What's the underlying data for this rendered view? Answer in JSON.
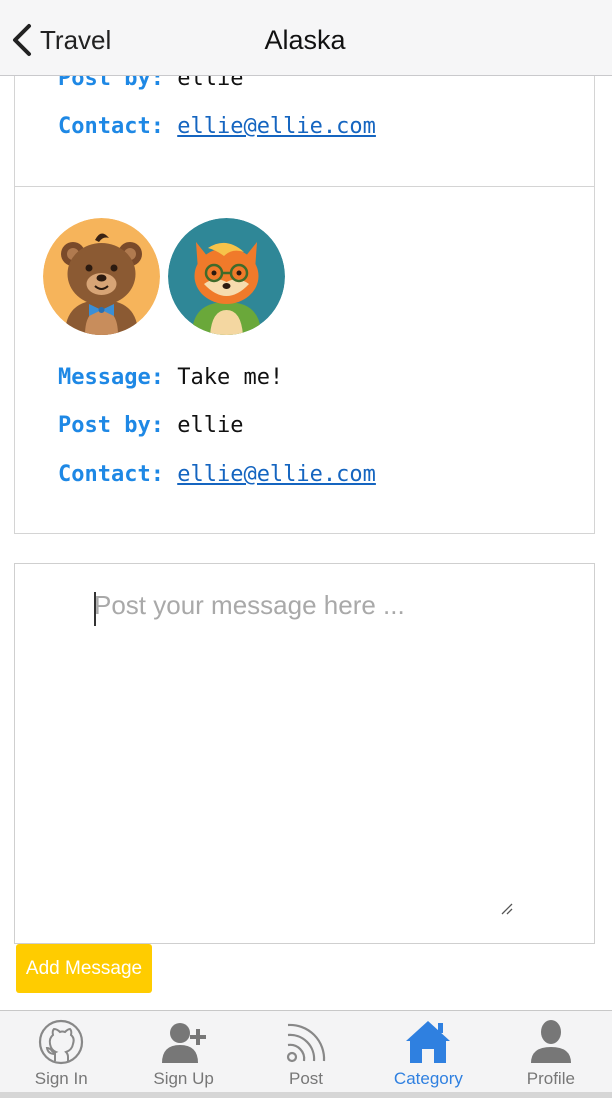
{
  "navbar": {
    "back_label": "Travel",
    "title": "Alaska"
  },
  "posts": [
    {
      "post_by_label": "Post by:",
      "post_by": "ellie",
      "contact_label": "Contact:",
      "contact": "ellie@ellie.com"
    },
    {
      "avatars": [
        "bear-avatar",
        "fox-avatar"
      ],
      "message_label": "Message:",
      "message": "Take me!",
      "post_by_label": "Post by:",
      "post_by": "ellie",
      "contact_label": "Contact:",
      "contact": "ellie@ellie.com"
    }
  ],
  "compose": {
    "placeholder": "Post your message here ...",
    "button_label": "Add Message"
  },
  "tabbar": {
    "items": [
      {
        "label": "Sign In",
        "icon": "github-icon"
      },
      {
        "label": "Sign Up",
        "icon": "add-user-icon"
      },
      {
        "label": "Post",
        "icon": "rss-icon"
      },
      {
        "label": "Category",
        "icon": "home-icon",
        "active": true
      },
      {
        "label": "Profile",
        "icon": "person-icon"
      }
    ]
  },
  "colors": {
    "label_blue": "#1e88e5",
    "link_blue": "#1565c0",
    "accent_yellow": "#ffcc00",
    "active_tab": "#2f80e0"
  }
}
